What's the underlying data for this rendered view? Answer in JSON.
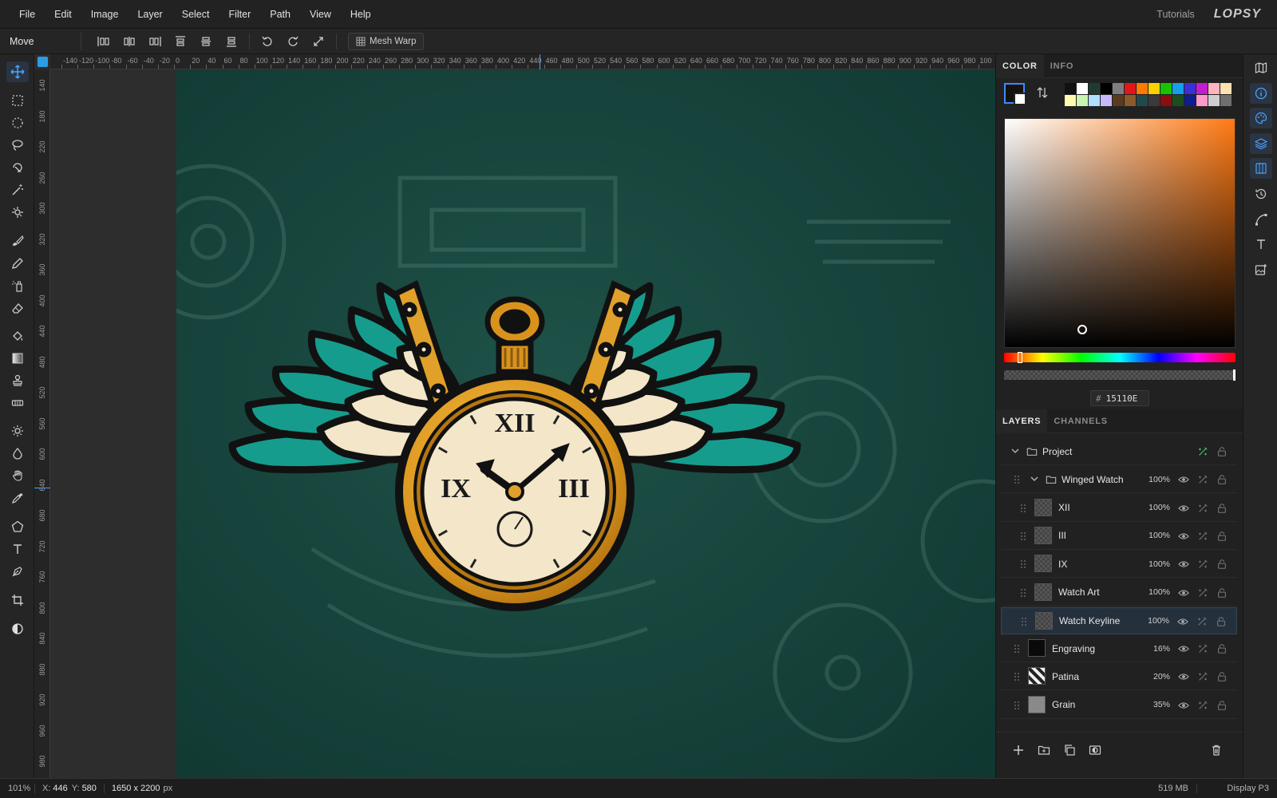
{
  "menu": {
    "items": [
      "File",
      "Edit",
      "Image",
      "Layer",
      "Select",
      "Filter",
      "Path",
      "View",
      "Help"
    ],
    "tutorials": "Tutorials",
    "logo": "LOPSY"
  },
  "options": {
    "tool_name": "Move",
    "mesh_warp": "Mesh Warp"
  },
  "tools": [
    {
      "name": "move-tool",
      "icon": "move-icon",
      "active": true
    },
    {
      "name": "rect-select-tool",
      "icon": "rect-select-icon"
    },
    {
      "name": "ellipse-select-tool",
      "icon": "ellipse-select-icon"
    },
    {
      "name": "lasso-tool",
      "icon": "lasso-icon"
    },
    {
      "name": "object-select-tool",
      "icon": "object-select-icon"
    },
    {
      "name": "magic-wand-tool",
      "icon": "magic-wand-icon"
    },
    {
      "name": "quick-select-tool",
      "icon": "quick-select-icon"
    },
    {
      "name": "brush-tool",
      "icon": "brush-icon"
    },
    {
      "name": "pencil-tool",
      "icon": "pencil-icon"
    },
    {
      "name": "spray-tool",
      "icon": "spray-icon"
    },
    {
      "name": "eraser-tool",
      "icon": "eraser-icon"
    },
    {
      "name": "bucket-tool",
      "icon": "bucket-icon"
    },
    {
      "name": "gradient-tool",
      "icon": "gradient-icon"
    },
    {
      "name": "clone-stamp-tool",
      "icon": "stamp-icon"
    },
    {
      "name": "healing-tool",
      "icon": "bandage-icon"
    },
    {
      "name": "dodge-tool",
      "icon": "sun-icon"
    },
    {
      "name": "blur-tool",
      "icon": "drop-icon"
    },
    {
      "name": "hand-tool",
      "icon": "hand-icon"
    },
    {
      "name": "eyedropper-tool",
      "icon": "eyedropper-icon"
    },
    {
      "name": "shape-tool",
      "icon": "pentagon-icon"
    },
    {
      "name": "text-tool",
      "icon": "text-icon"
    },
    {
      "name": "pen-tool",
      "icon": "pen-icon"
    },
    {
      "name": "crop-tool",
      "icon": "crop-icon"
    },
    {
      "name": "mask-mode-tool",
      "icon": "half-circle-icon"
    }
  ],
  "ruler": {
    "h_labels": [
      "-140",
      "-120",
      "-100",
      "-80",
      "-60",
      "-40",
      "-20",
      "0",
      "20",
      "40",
      "60",
      "80",
      "100",
      "120",
      "140",
      "160",
      "180",
      "200",
      "220",
      "240",
      "260",
      "280",
      "300",
      "320",
      "340",
      "360",
      "380",
      "400",
      "420",
      "440",
      "460",
      "480",
      "500",
      "520",
      "540",
      "560",
      "580",
      "600",
      "620",
      "640",
      "660",
      "680",
      "700",
      "720",
      "740",
      "760",
      "780",
      "800",
      "820",
      "840",
      "860",
      "880",
      "900",
      "920",
      "940",
      "960",
      "980",
      "100"
    ],
    "v_labels": [
      "140",
      "180",
      "220",
      "260",
      "300",
      "320",
      "360",
      "400",
      "440",
      "480",
      "520",
      "560",
      "600",
      "640",
      "680",
      "720",
      "760",
      "800",
      "840",
      "880",
      "920",
      "960",
      "980"
    ]
  },
  "canvas": {
    "numerals": {
      "top": "XII",
      "left": "IX",
      "right": "III"
    }
  },
  "color_panel": {
    "tabs": [
      "COLOR",
      "INFO"
    ],
    "hex_prefix": "#",
    "hex": "15110E",
    "swatches_row1": [
      "#111111",
      "#ffffff",
      "#1f3a33",
      "#000000",
      "#7f7f7f",
      "#e0161b",
      "#ff7a00",
      "#ffd000",
      "#16c400",
      "#13a0e8",
      "#3b2fd8",
      "#c41ccf",
      "#ffb3c0",
      "#ffe0b0"
    ],
    "swatches_row2": [
      "#fff9b0",
      "#c8f5b0",
      "#b0e0ff",
      "#c8b8ff",
      "#5a3b1e",
      "#8a5a2b",
      "#204a4a",
      "#3a3a3a",
      "#8a0d10",
      "#1d4d1d",
      "#0d1d8a",
      "#ff99cc",
      "#cfcfcf",
      "#6f6f6f"
    ]
  },
  "layers_panel": {
    "tabs": [
      "LAYERS",
      "CHANNELS"
    ],
    "layers": [
      {
        "name": "Project",
        "opacity": "",
        "indent": 0,
        "group": true,
        "expanded": true
      },
      {
        "name": "Winged Watch",
        "opacity": "100%",
        "indent": 1,
        "group": true,
        "expanded": true
      },
      {
        "name": "XII",
        "opacity": "100%",
        "indent": 2
      },
      {
        "name": "III",
        "opacity": "100%",
        "indent": 2
      },
      {
        "name": "IX",
        "opacity": "100%",
        "indent": 2
      },
      {
        "name": "Watch Art",
        "opacity": "100%",
        "indent": 2
      },
      {
        "name": "Watch Keyline",
        "opacity": "100%",
        "indent": 2,
        "selected": true
      },
      {
        "name": "Engraving",
        "opacity": "16%",
        "indent": 1
      },
      {
        "name": "Patina",
        "opacity": "20%",
        "indent": 1
      },
      {
        "name": "Grain",
        "opacity": "35%",
        "indent": 1
      }
    ]
  },
  "status": {
    "zoom": "101%",
    "x_label": "X:",
    "x": "446",
    "y_label": "Y:",
    "y": "580",
    "doc_size": "1650 x 2200",
    "unit": "px",
    "memory": "519 MB",
    "profile": "Display P3"
  }
}
